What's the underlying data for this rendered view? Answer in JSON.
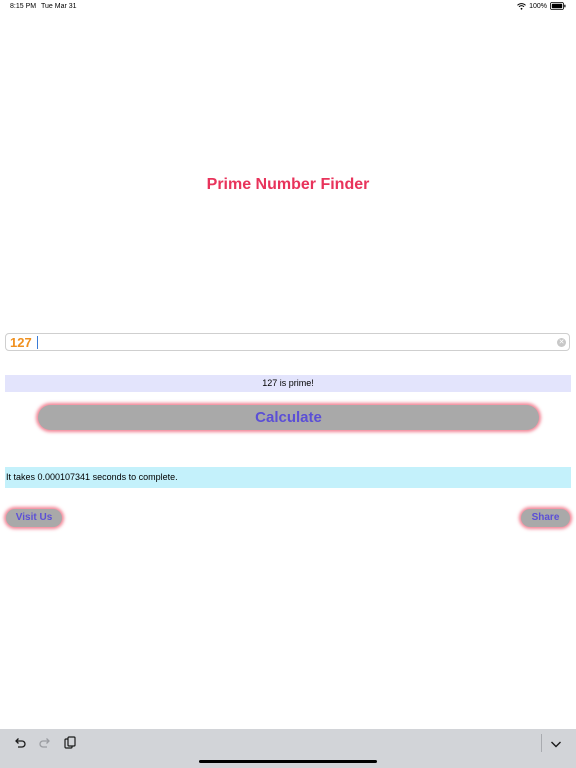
{
  "status_bar": {
    "time": "8:15 PM",
    "date": "Tue Mar 31",
    "battery": "100%"
  },
  "app": {
    "title": "Prime Number Finder"
  },
  "input": {
    "value": "127"
  },
  "result": {
    "message": "127 is prime!"
  },
  "calculate_button": {
    "label": "Calculate"
  },
  "timing": {
    "message": "It takes 0.000107341 seconds to complete."
  },
  "links": {
    "visit_label": "Visit Us",
    "share_label": "Share"
  },
  "colors": {
    "title": "#e8335b",
    "input_text": "#f0901e",
    "button_text": "#5b4fd6",
    "button_bg": "#a9a9a9",
    "result_bg": "#e3e4fc",
    "timing_bg": "#c4f1fb"
  },
  "icons": {
    "toolbar": [
      "undo-icon",
      "redo-icon",
      "paste-icon",
      "keyboard-dismiss-icon"
    ],
    "status": [
      "wifi-icon",
      "battery-icon"
    ]
  }
}
